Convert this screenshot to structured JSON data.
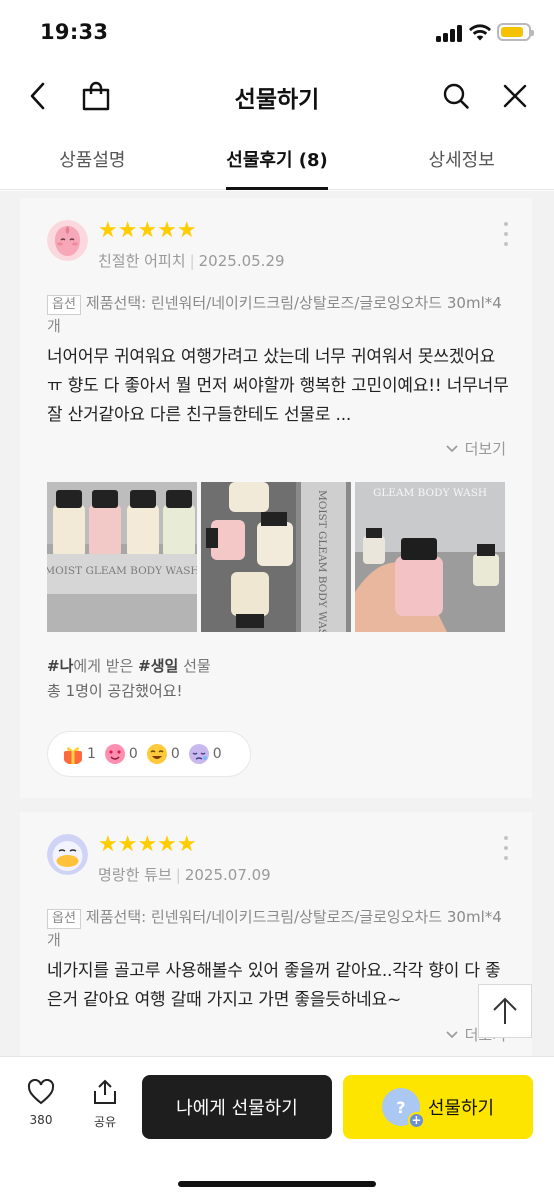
{
  "status_bar": {
    "time": "19:33"
  },
  "header": {
    "title": "선물하기"
  },
  "tabs": [
    {
      "label": "상품설명",
      "active": false
    },
    {
      "label": "선물후기 (8)",
      "active": true
    },
    {
      "label": "상세정보",
      "active": false
    }
  ],
  "reviews": [
    {
      "rating": "★★★★★",
      "nickname": "친절한 어피치",
      "date": "2025.05.29",
      "option_badge": "옵션",
      "option_text": "제품선택: 린넨워터/네이키드크림/상탈로즈/글로잉오차드 30ml*4개",
      "body": "너어어무 귀여워요 여행가려고 샀는데 너무 귀여워서 못쓰겠어요ㅠ 향도 다 좋아서 뭘 먼저 써야할까 행복한 고민이예요!! 너무너무 잘 산거같아요 다른 친구들한테도 선물로 ...",
      "more_label": "더보기",
      "photo_texts": [
        "MOIST GLEAM BODY WASH",
        "MOIST GLEAM BODY WASH",
        "GLEAM BODY WASH"
      ],
      "tags": {
        "tag1": "#나",
        "text1": "에게 받은 ",
        "tag2": "#생일",
        "text2": " 선물"
      },
      "empathy": "총 1명이 공감했어요!",
      "reactions": [
        {
          "icon": "gift-emoji",
          "count": "1"
        },
        {
          "icon": "heart-eyes-emoji",
          "count": "0"
        },
        {
          "icon": "laugh-emoji",
          "count": "0"
        },
        {
          "icon": "sad-emoji",
          "count": "0"
        }
      ]
    },
    {
      "rating": "★★★★★",
      "nickname": "명랑한 튜브",
      "date": "2025.07.09",
      "option_badge": "옵션",
      "option_text": "제품선택: 린넨워터/네이키드크림/상탈로즈/글로잉오차드 30ml*4개",
      "body": "네가지를 골고루 사용해볼수 있어 좋을꺼 같아요..각각 향이 다 좋은거 같아요 여행 갈때 가지고 가면 좋을듯하네요~",
      "more_label": "더보기"
    }
  ],
  "bottom_bar": {
    "like_count": "380",
    "share_label": "공유",
    "self_gift_label": "나에게 선물하기",
    "gift_label": "선물하기",
    "gift_avatar_text": "?"
  },
  "colors": {
    "accent_yellow": "#fee500",
    "star": "#ffcd00",
    "dark_button": "#1e1e1e"
  }
}
